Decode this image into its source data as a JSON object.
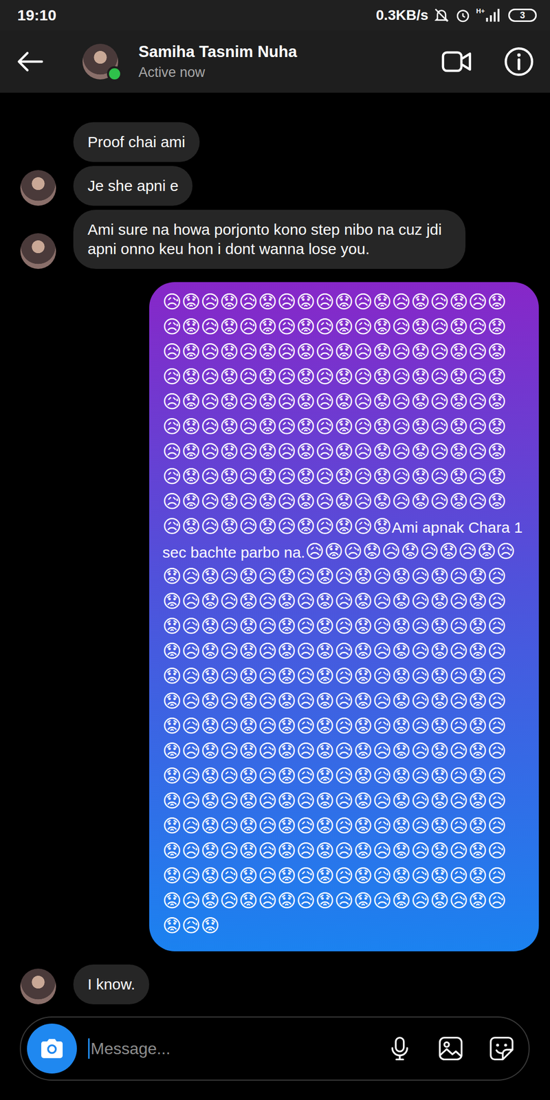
{
  "status_bar": {
    "time": "19:10",
    "network_speed": "0.3KB/s",
    "network_type": "H+",
    "battery": "3"
  },
  "header": {
    "name": "Samiha Tasnim Nuha",
    "status": "Active now",
    "online": true
  },
  "messages": [
    {
      "sender": "them",
      "show_avatar": false,
      "parts": [
        {
          "kind": "text",
          "text": "Proof chai ami"
        }
      ]
    },
    {
      "sender": "them",
      "show_avatar": true,
      "parts": [
        {
          "kind": "text",
          "text": "Je she apni e"
        }
      ]
    },
    {
      "sender": "them",
      "show_avatar": true,
      "parts": [
        {
          "kind": "text",
          "text": "Ami sure na howa porjonto kono step nibo na cuz jdi apni onno keu hon i dont wanna lose you."
        }
      ]
    },
    {
      "sender": "me",
      "show_avatar": false,
      "parts": [
        {
          "kind": "emoji",
          "text": "😥😟😥😟😥😟😥😟😥😟😥😟😥😟😥😟😥😟😥😟😥😟😥😟😥😟😥😟😥😟😥😟😥😟😥😟😥😟😥😟😥😟😥😟😥😟😥😟😥😟😥😟😥😟😥😟😥😟😥😟😥😟😥😟😥😟😥😟😥😟😥😟😥😟😥😟😥😟😥😟😥😟😥😟😥😟😥😟😥😟😥😟😥😟😥😟😥😟😥😟😥😟😥😟😥😟😥😟😥😟😥😟😥😟😥😟😥😟😥😟😥😟😥😟😥😟😥😟😥😟😥😟😥😟😥😟😥😟😥😟😥😟😥😟😥😟😥😟😥😟😥😟😥😟😥😟😥😟😥😟😥😟😥😟😥😟😥😟😥😟😥😟😥😟"
        },
        {
          "kind": "text",
          "text": "Ami apnak Chara 1 sec bachte parbo na."
        },
        {
          "kind": "emoji",
          "text": "😥😟😥😟😥😟😥😟😥😟😥😟😥😟😥😟😥😟😥😟😥😟😥😟😥😟😥😟😥😟😥😟😥😟😥😟😥😟😥😟😥😟😥😟😥😟😥😟😥😟😥😟😥😟😥😟😥😟😥😟😥😟😥😟😥😟😥😟😥😟😥😟😥😟😥😟😥😟😥😟😥😟😥😟😥😟😥😟😥😟😥😟😥😟😥😟😥😟😥😟😥😟😥😟😥😟😥😟😥😟😥😟😥😟😥😟😥😟😥😟😥😟😥😟😥😟😥😟😥😟😥😟😥😟😥😟😥😟😥😟😥😟😥😟😥😟😥😟😥😟😥😟😥😟😥😟😥😟😥😟😥😟😥😟😥😟😥😟😥😟😥😟😥😟😥😟😥😟😥😟😥😟😥😟😥😟😥😟😥😟😥😟😥😟😥😟😥😟😥😟😥😟😥😟😥😟😥😟😥😟😥😟😥😟😥😟😥😟😥😟😥😟😥😟😥😟😥😟😥😟😥😟😥😟😥😟😥😟😥😟😥😟😥😟😥😟😥😟😥😟😥😟😥😟😥😟😥😟😥😟😥😟😥😟😥😟"
        }
      ]
    },
    {
      "sender": "them",
      "show_avatar": true,
      "parts": [
        {
          "kind": "text",
          "text": "I know."
        }
      ]
    }
  ],
  "composer": {
    "placeholder": "Message..."
  }
}
